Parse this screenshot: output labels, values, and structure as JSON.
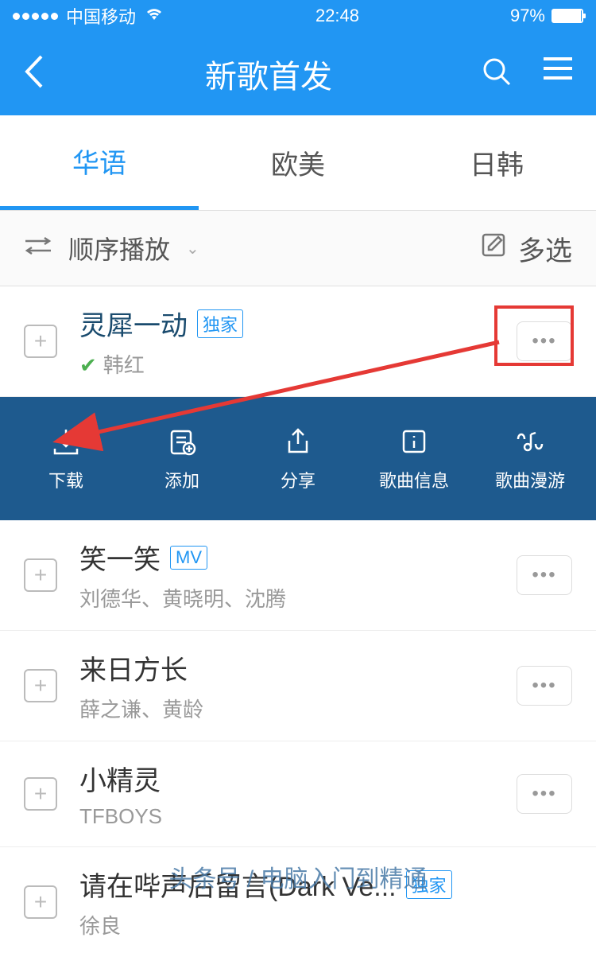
{
  "status": {
    "carrier": "中国移动",
    "time": "22:48",
    "battery_pct": "97%"
  },
  "nav": {
    "title": "新歌首发"
  },
  "tabs": [
    {
      "label": "华语",
      "active": true
    },
    {
      "label": "欧美",
      "active": false
    },
    {
      "label": "日韩",
      "active": false
    }
  ],
  "controls": {
    "play_mode": "顺序播放",
    "multi_select": "多选"
  },
  "songs": [
    {
      "title": "灵犀一动",
      "badge": "独家",
      "artist": "韩红",
      "verified": true,
      "title_dark": true,
      "expanded": true
    },
    {
      "title": "笑一笑",
      "badge": "MV",
      "artist": "刘德华、黄晓明、沈腾"
    },
    {
      "title": "来日方长",
      "artist": "薛之谦、黄龄"
    },
    {
      "title": "小精灵",
      "artist": "TFBOYS"
    },
    {
      "title": "请在哔声后留言(Dark Ve...",
      "badge": "独家",
      "artist": "徐良"
    }
  ],
  "actions": [
    {
      "label": "下载"
    },
    {
      "label": "添加"
    },
    {
      "label": "分享"
    },
    {
      "label": "歌曲信息"
    },
    {
      "label": "歌曲漫游"
    }
  ],
  "watermark": "头条号 / 电脑入门到精通"
}
